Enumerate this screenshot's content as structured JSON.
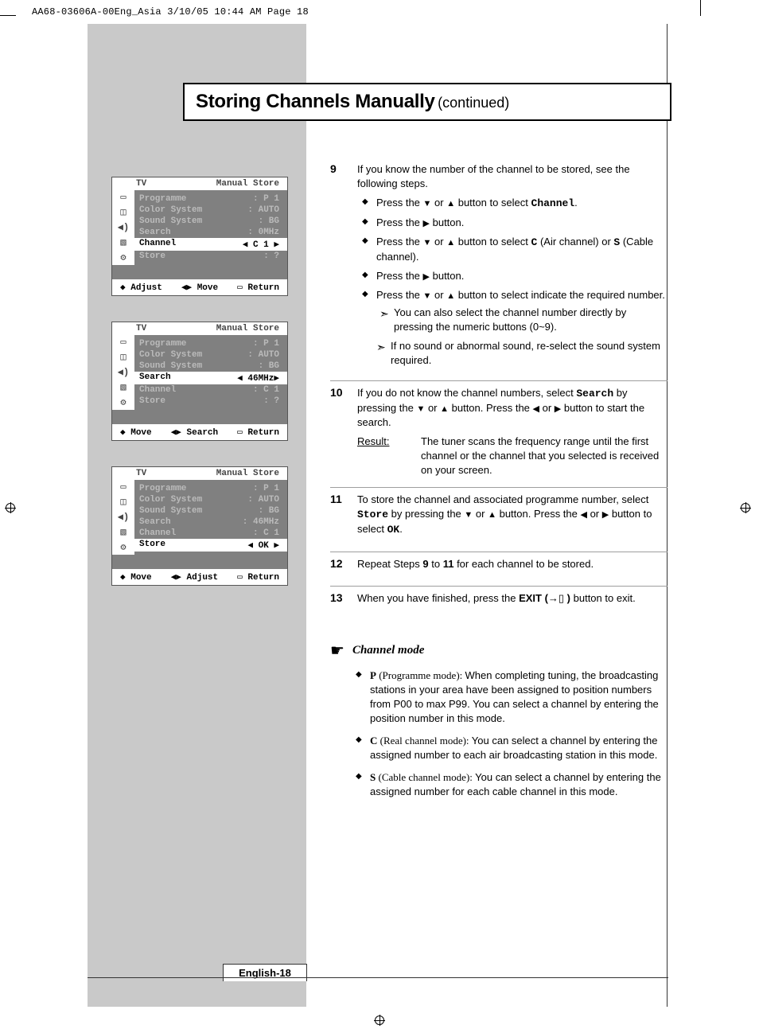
{
  "slug": "AA68-03606A-00Eng_Asia  3/10/05  10:44 AM  Page 18",
  "title_main": "Storing Channels Manually",
  "title_sub": "(continued)",
  "steps": {
    "s9": {
      "num": "9",
      "intro": "If you know the number of the channel to be stored, see the following steps.",
      "b1a": "Press the ",
      "b1b": " or ",
      "b1c": " button to select ",
      "b1_code": "Channel",
      "b1_end": ".",
      "b2a": "Press the ",
      "b2b": " button.",
      "b3a": "Press the ",
      "b3b": " or ",
      "b3c": " button to select ",
      "b3_c": "C",
      "b3_air": " (Air channel) or ",
      "b3_s": "S",
      "b3_cable": " (Cable channel).",
      "b4a": "Press the ",
      "b4b": " button.",
      "b5a": "Press the ",
      "b5b": " or ",
      "b5c": " button to select indicate the required number.",
      "note1": "You can also select the channel number directly by pressing the numeric buttons (0~9).",
      "note2": "If no sound or abnormal sound, re-select the sound system required."
    },
    "s10": {
      "num": "10",
      "p1a": "If you do not know the channel numbers, select ",
      "p1_code": "Search",
      "p1b": " by pressing the ",
      "p1c": " or ",
      "p1d": " button. Press the ",
      "p1e": " or ",
      "p1f": " button to start the search.",
      "result_label": "Result:",
      "result_text": "The tuner scans the frequency range until the first channel or the channel that you selected is received on your screen."
    },
    "s11": {
      "num": "11",
      "a": "To store the channel and associated programme number, select ",
      "code": "Store",
      "b": " by pressing the ",
      "c": " or ",
      "d": " button. Press the ",
      "e": " or ",
      "f": " button to select ",
      "ok": "OK",
      "end": "."
    },
    "s12": {
      "num": "12",
      "a": "Repeat Steps ",
      "b9": "9",
      "mid": " to ",
      "b11": "11",
      "end": " for each channel to be stored."
    },
    "s13": {
      "num": "13",
      "a": "When you have finished, press the ",
      "exit": "EXIT (",
      "exitend": " )",
      "end": " button to exit."
    }
  },
  "osd": {
    "tv": "TV",
    "manual_store": "Manual Store",
    "labels": {
      "programme": "Programme",
      "color_system": "Color System",
      "sound_system": "Sound System",
      "search": "Search",
      "channel": "Channel",
      "store": "Store"
    },
    "panel1": {
      "programme": ": P 1",
      "color": ": AUTO",
      "sound": ": BG",
      "search": ":   0MHz",
      "channel": "◀ C 1   ▶",
      "store": ": ?",
      "foot": {
        "a": "◆ Adjust",
        "b": "◀▶ Move",
        "c": "▭ Return"
      }
    },
    "panel2": {
      "programme": ": P 1",
      "color": ": AUTO",
      "sound": ": BG",
      "search": "◀  46MHz▶",
      "channel": ": C 1",
      "store": ": ?",
      "foot": {
        "a": "◆ Move",
        "b": "◀▶ Search",
        "c": "▭ Return"
      }
    },
    "panel3": {
      "programme": ": P 1",
      "color": ": AUTO",
      "sound": ": BG",
      "search": ":  46MHz",
      "channel": ": C 1",
      "store": "◀ OK    ▶",
      "foot": {
        "a": "◆ Move",
        "b": "◀▶ Adjust",
        "c": "▭ Return"
      }
    }
  },
  "channel_mode": {
    "title": "Channel mode",
    "p": {
      "label": "P",
      "paren": " (Programme mode): ",
      "text": "When completing tuning, the broadcasting stations in your area have been assigned to position numbers from P00 to max P99. You can select a channel by entering the position number in this mode."
    },
    "c": {
      "label": "C",
      "paren": " (Real channel mode): ",
      "text": "You can select a channel by entering the assigned number to each air broadcasting station in this mode."
    },
    "s": {
      "label": "S",
      "paren": " (Cable channel mode): ",
      "text": "You can select a channel by entering the assigned number for each cable channel in this mode."
    }
  },
  "page_label": "English-18"
}
